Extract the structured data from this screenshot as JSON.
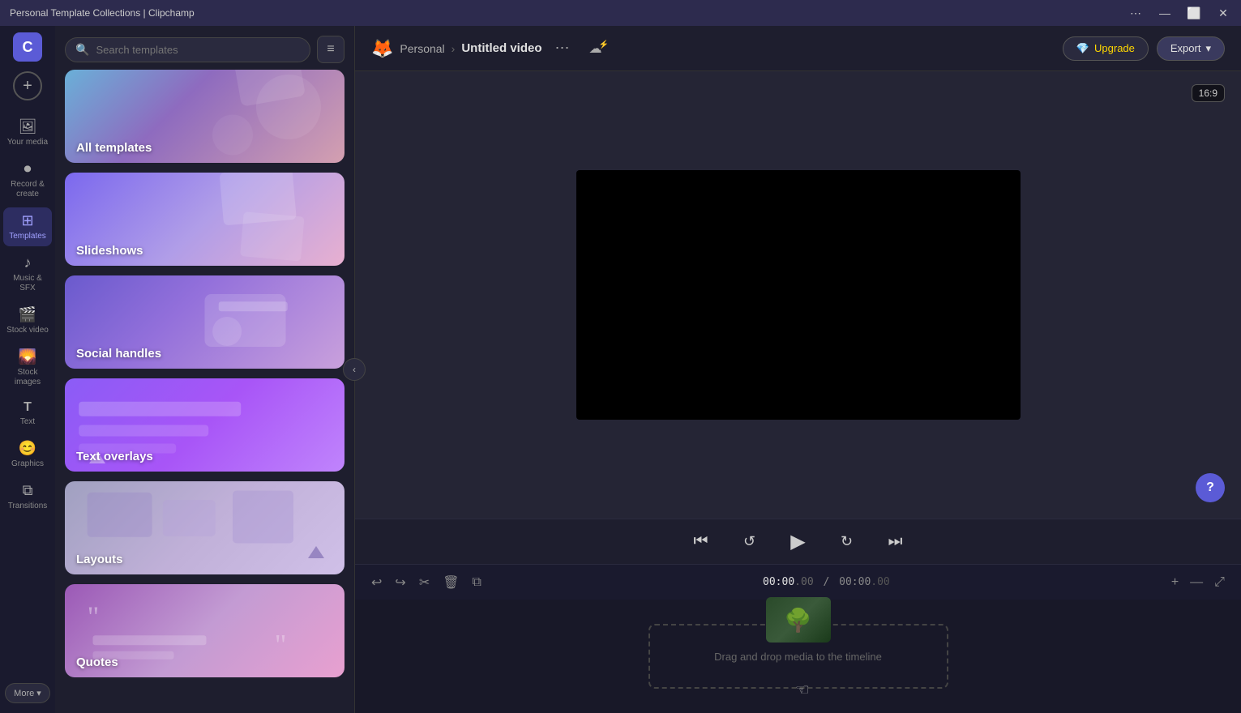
{
  "titleBar": {
    "title": "Personal Template Collections | Clipchamp",
    "controls": {
      "more": "⋯",
      "minimize": "—",
      "maximize": "⬜",
      "close": "✕"
    }
  },
  "iconBar": {
    "logo": "C",
    "addLabel": "+",
    "items": [
      {
        "id": "your-media",
        "icon": "🖼",
        "label": "Your media"
      },
      {
        "id": "record-create",
        "icon": "⏺",
        "label": "Record & create"
      },
      {
        "id": "templates",
        "icon": "⊞",
        "label": "Templates",
        "active": true
      },
      {
        "id": "music-sfx",
        "icon": "♪",
        "label": "Music & SFX"
      },
      {
        "id": "stock-video",
        "icon": "🎬",
        "label": "Stock video"
      },
      {
        "id": "stock-images",
        "icon": "🌄",
        "label": "Stock images"
      },
      {
        "id": "text",
        "icon": "T",
        "label": "Text"
      },
      {
        "id": "graphics",
        "icon": "😊",
        "label": "Graphics"
      },
      {
        "id": "transitions",
        "icon": "⧉",
        "label": "Transitions"
      }
    ],
    "more": "More ▾"
  },
  "sidebar": {
    "searchPlaceholder": "Search templates",
    "filterIcon": "≡",
    "templates": [
      {
        "id": "all-templates",
        "label": "All templates",
        "bgClass": "bg-all"
      },
      {
        "id": "slideshows",
        "label": "Slideshows",
        "bgClass": "bg-slideshows"
      },
      {
        "id": "social-handles",
        "label": "Social handles",
        "bgClass": "bg-social"
      },
      {
        "id": "text-overlays",
        "label": "Text overlays",
        "bgClass": "bg-text-overlays"
      },
      {
        "id": "layouts",
        "label": "Layouts",
        "bgClass": "bg-layouts"
      },
      {
        "id": "quotes",
        "label": "Quotes",
        "bgClass": "bg-quotes"
      }
    ]
  },
  "topBar": {
    "breadcrumbIcon": "🦊",
    "personal": "Personal",
    "separator": "›",
    "videoTitle": "Untitled video",
    "moreIcon": "⋯",
    "cloudIcon": "☁",
    "upgradeLabel": "Upgrade",
    "upgradeIcon": "💎",
    "exportLabel": "Export",
    "exportDropIcon": "▾"
  },
  "preview": {
    "aspectRatio": "16:9",
    "helpLabel": "?"
  },
  "playerControls": {
    "skipBack": "⏮",
    "rewind": "↺",
    "play": "▶",
    "forward": "↻",
    "skipForward": "⏭"
  },
  "timelineToolbar": {
    "undo": "↩",
    "redo": "↪",
    "cut": "✂",
    "delete": "🗑",
    "duplicate": "⧉",
    "timeCurrentDisplay": "00:00",
    "timeCurrentMs": ".00",
    "timeSeparator": "/",
    "timeTotalDisplay": "00:00",
    "timeTotalMs": ".00",
    "addBtn": "+",
    "zoomOut": "—",
    "expand": "⤢"
  },
  "timeline": {
    "dropText": "Drag and drop media to the timeline"
  }
}
